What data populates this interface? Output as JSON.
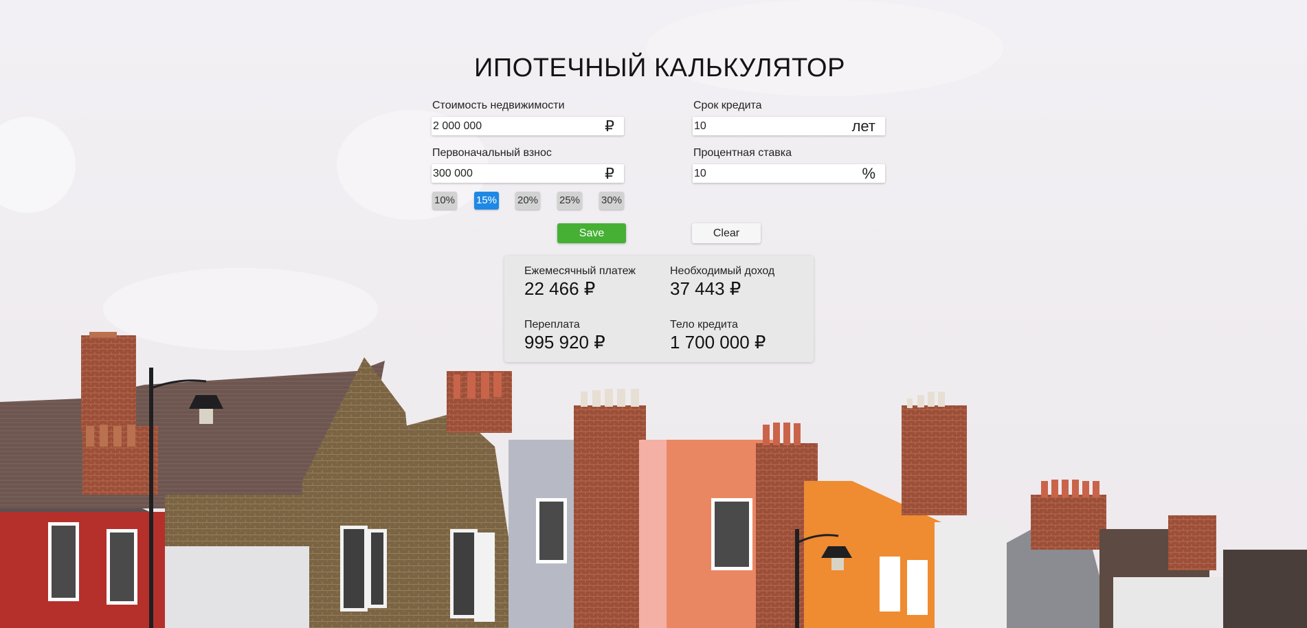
{
  "title": "ИПОТЕЧНЫЙ КАЛЬКУЛЯТОР",
  "fields": {
    "property_cost": {
      "label": "Стоимость недвижимости",
      "value": "2 000 000",
      "unit": "₽"
    },
    "loan_term": {
      "label": "Срок кредита",
      "value": "10",
      "unit": "лет"
    },
    "down_payment": {
      "label": "Первоначальный взнос",
      "value": "300 000",
      "unit": "₽"
    },
    "interest_rate": {
      "label": "Процентная ставка",
      "value": "10",
      "unit": "%"
    }
  },
  "down_payment_chips": [
    "10%",
    "15%",
    "20%",
    "25%",
    "30%"
  ],
  "selected_chip": "15%",
  "buttons": {
    "save": "Save",
    "clear": "Clear"
  },
  "results": {
    "monthly_payment": {
      "label": "Ежемесячный платеж",
      "value": "22 466 ₽"
    },
    "required_income": {
      "label": "Необходимый доход",
      "value": "37 443 ₽"
    },
    "overpayment": {
      "label": "Переплата",
      "value": "995 920 ₽"
    },
    "loan_body": {
      "label": "Тело кредита",
      "value": "1 700 000 ₽"
    }
  },
  "colors": {
    "save": "#45b034",
    "chip_active": "#1e88e5",
    "chip": "#d2d2d2"
  }
}
